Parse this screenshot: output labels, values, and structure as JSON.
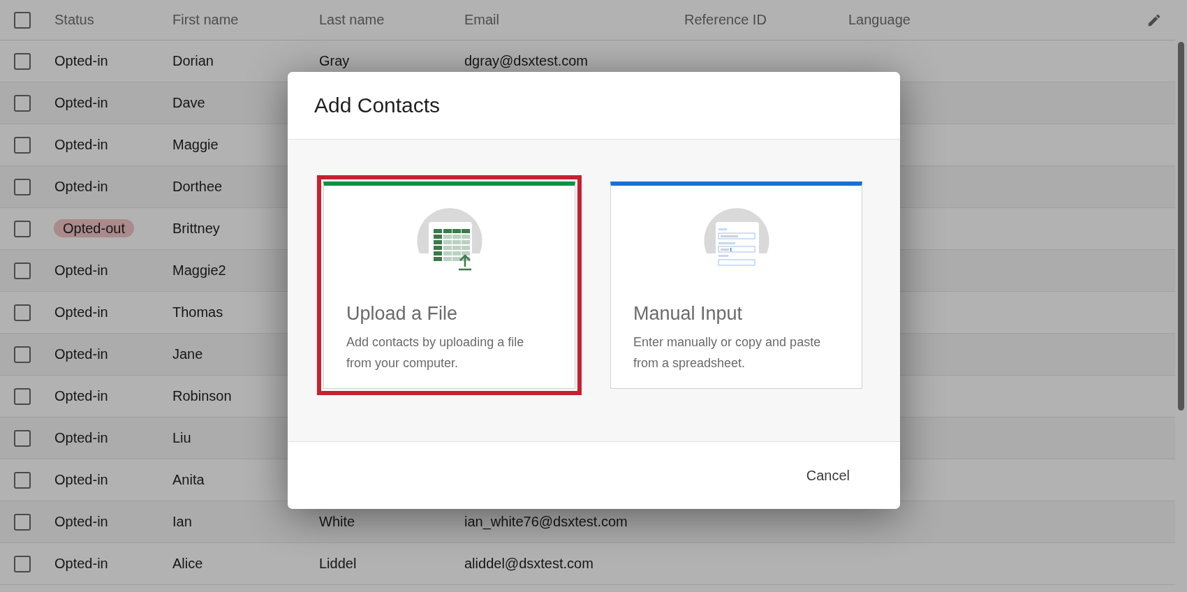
{
  "table": {
    "all_checked": false,
    "columns": [
      "Status",
      "First name",
      "Last name",
      "Email",
      "Reference ID",
      "Language"
    ],
    "rows": [
      {
        "checked": false,
        "status": "Opted-in",
        "status_tag": false,
        "first_name": "Dorian",
        "last_name": "Gray",
        "email": "dgray@dsxtest.com"
      },
      {
        "checked": false,
        "status": "Opted-in",
        "status_tag": false,
        "first_name": "Dave"
      },
      {
        "checked": false,
        "status": "Opted-in",
        "status_tag": false,
        "first_name": "Maggie"
      },
      {
        "checked": false,
        "status": "Opted-in",
        "status_tag": false,
        "first_name": "Dorthee"
      },
      {
        "checked": false,
        "status": "Opted-out",
        "status_tag": true,
        "first_name": "Brittney"
      },
      {
        "checked": false,
        "status": "Opted-in",
        "status_tag": false,
        "first_name": "Maggie2"
      },
      {
        "checked": false,
        "status": "Opted-in",
        "status_tag": false,
        "first_name": "Thomas"
      },
      {
        "checked": false,
        "status": "Opted-in",
        "status_tag": false,
        "first_name": "Jane"
      },
      {
        "checked": false,
        "status": "Opted-in",
        "status_tag": false,
        "first_name": "Robinson"
      },
      {
        "checked": false,
        "status": "Opted-in",
        "status_tag": false,
        "first_name": "Liu"
      },
      {
        "checked": false,
        "status": "Opted-in",
        "status_tag": false,
        "first_name": "Anita"
      },
      {
        "checked": false,
        "status": "Opted-in",
        "status_tag": false,
        "first_name": "Ian",
        "last_name": "White",
        "email": "ian_white76@dsxtest.com"
      },
      {
        "checked": false,
        "status": "Opted-in",
        "status_tag": false,
        "first_name": "Alice",
        "last_name": "Liddel",
        "email": "aliddel@dsxtest.com"
      }
    ]
  },
  "dialog": {
    "title": "Add Contacts",
    "options": [
      {
        "kind": "file",
        "title": "Upload a File",
        "description": "Add contacts by uploading a file from your computer.",
        "color": "#0c9247",
        "selected": true
      },
      {
        "kind": "manual",
        "title": "Manual Input",
        "description": "Enter manually or copy and paste from a spreadsheet.",
        "color": "#1a6fd6",
        "selected": false
      }
    ],
    "buttons": [
      "Cancel"
    ]
  }
}
